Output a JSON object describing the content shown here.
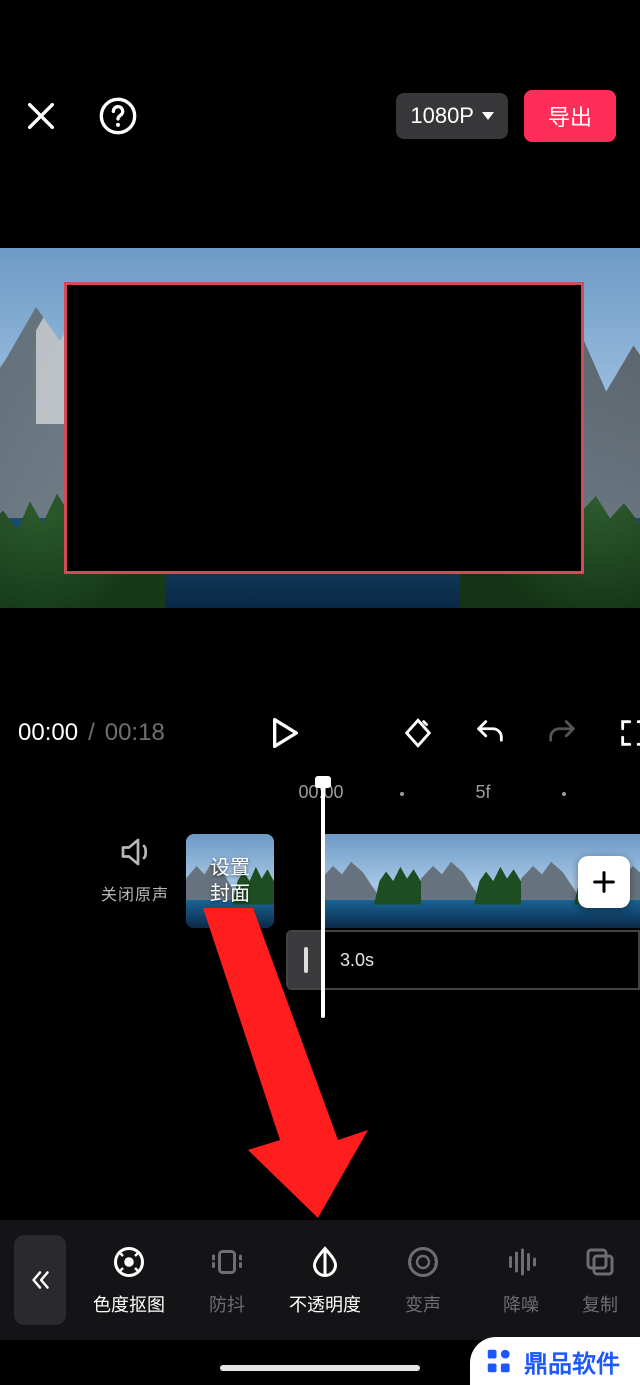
{
  "header": {
    "resolution_label": "1080P",
    "export_label": "导出"
  },
  "transport": {
    "current_time": "00:00",
    "separator": "/",
    "duration": "00:18"
  },
  "timeline": {
    "ruler_zero": "00:00",
    "ruler_tick": "5f",
    "mute_label": "关闭原声",
    "cover_label": "设置\n封面",
    "overlay_clip_duration": "3.0s"
  },
  "toolbar": {
    "items": [
      {
        "label": "色度抠图",
        "active": true
      },
      {
        "label": "防抖",
        "active": false
      },
      {
        "label": "不透明度",
        "active": true
      },
      {
        "label": "变声",
        "active": false
      },
      {
        "label": "降噪",
        "active": false
      },
      {
        "label": "复制",
        "active": false
      }
    ]
  },
  "watermark": {
    "text": "鼎品软件"
  }
}
